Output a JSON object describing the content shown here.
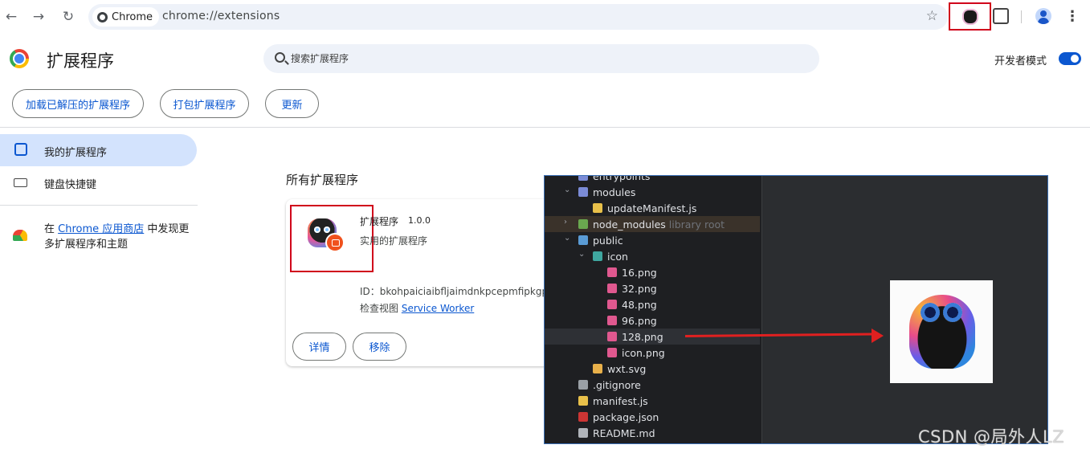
{
  "browser": {
    "chip_label": "Chrome",
    "url": "chrome://extensions"
  },
  "header": {
    "title": "扩展程序",
    "search_placeholder": "搜索扩展程序",
    "dev_mode_label": "开发者模式",
    "dev_mode_on": true
  },
  "actions": {
    "load_unpacked": "加载已解压的扩展程序",
    "pack": "打包扩展程序",
    "update": "更新"
  },
  "sidebar": {
    "items": [
      {
        "label": "我的扩展程序",
        "active": true
      },
      {
        "label": "键盘快捷键",
        "active": false
      }
    ],
    "store_prefix": "在 ",
    "store_link": "Chrome 应用商店",
    "store_suffix": " 中发现更多扩展程序和主题"
  },
  "main": {
    "section_title": "所有扩展程序",
    "extension": {
      "name": "扩展程序",
      "version": "1.0.0",
      "description": "实用的扩展程序",
      "id_line": "ID：bkohpaiciaibfljaimdnkpcepmfipkgp",
      "inspect_prefix": "检查视图 ",
      "inspect_link": "Service Worker",
      "details_label": "详情",
      "remove_label": "移除"
    }
  },
  "ide": {
    "tree": [
      {
        "label": "entrypoints",
        "depth": 1,
        "chevron": "",
        "icon": "folder"
      },
      {
        "label": "modules",
        "depth": 1,
        "chevron": "down",
        "icon": "folder"
      },
      {
        "label": "updateManifest.js",
        "depth": 2,
        "chevron": "",
        "icon": "js"
      },
      {
        "label": "node_modules",
        "suffix": "library root",
        "depth": 1,
        "chevron": "right",
        "icon": "folder-green"
      },
      {
        "label": "public",
        "depth": 1,
        "chevron": "down",
        "icon": "folder-web"
      },
      {
        "label": "icon",
        "depth": 2,
        "chevron": "down",
        "icon": "folder-teal"
      },
      {
        "label": "16.png",
        "depth": 3,
        "chevron": "",
        "icon": "image"
      },
      {
        "label": "32.png",
        "depth": 3,
        "chevron": "",
        "icon": "image"
      },
      {
        "label": "48.png",
        "depth": 3,
        "chevron": "",
        "icon": "image"
      },
      {
        "label": "96.png",
        "depth": 3,
        "chevron": "",
        "icon": "image"
      },
      {
        "label": "128.png",
        "depth": 3,
        "chevron": "",
        "icon": "image",
        "selected": true
      },
      {
        "label": "icon.png",
        "depth": 3,
        "chevron": "",
        "icon": "image"
      },
      {
        "label": "wxt.svg",
        "depth": 2,
        "chevron": "",
        "icon": "svg"
      },
      {
        "label": ".gitignore",
        "depth": 1,
        "chevron": "",
        "icon": "git"
      },
      {
        "label": "manifest.js",
        "depth": 1,
        "chevron": "",
        "icon": "js"
      },
      {
        "label": "package.json",
        "depth": 1,
        "chevron": "",
        "icon": "npm"
      },
      {
        "label": "README.md",
        "depth": 1,
        "chevron": "",
        "icon": "md"
      }
    ]
  },
  "watermark": "CSDN @局外人LZ",
  "colors": {
    "accent": "#0b57d0",
    "highlight_box": "#d0021b",
    "arrow": "#e02020",
    "ide_bg": "#1e1f22"
  }
}
